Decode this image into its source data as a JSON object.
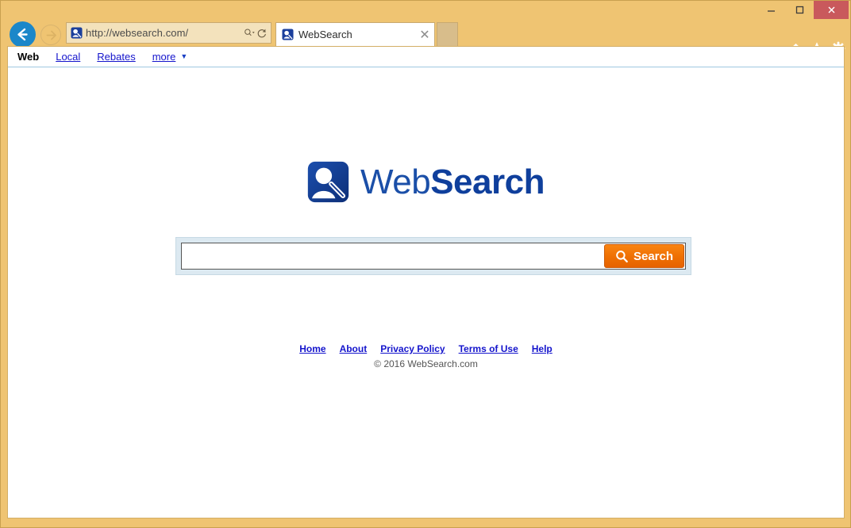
{
  "browser": {
    "window_controls": {
      "minimize": "minimize-icon",
      "maximize": "maximize-icon",
      "close": "close-icon"
    },
    "back_icon": "back-arrow-icon",
    "forward_icon": "forward-arrow-icon",
    "address": {
      "url": "http://websearch.com/",
      "favicon": "websearch-favicon",
      "search_icon": "search-dropdown-icon",
      "refresh_icon": "refresh-icon"
    },
    "tab": {
      "title": "WebSearch",
      "favicon": "websearch-favicon",
      "close_label": "✕"
    },
    "new_tab_label": "",
    "toolbar_icons": [
      "home-icon",
      "favorites-star-icon",
      "settings-gear-icon"
    ]
  },
  "sitenav": {
    "items": [
      {
        "label": "Web",
        "active": true
      },
      {
        "label": "Local",
        "active": false
      },
      {
        "label": "Rebates",
        "active": false
      }
    ],
    "more_label": "more",
    "more_caret": "▼"
  },
  "logo": {
    "mark": "websearch-logo-mark",
    "text_thin": "Web",
    "text_bold": "Search"
  },
  "search": {
    "value": "",
    "placeholder": "",
    "button_label": "Search",
    "button_icon": "magnifier-icon"
  },
  "footer": {
    "links": [
      "Home",
      "About",
      "Privacy Policy",
      "Terms of Use",
      "Help"
    ],
    "copyright": "© 2016 WebSearch.com"
  },
  "colors": {
    "chrome_gold": "#efc472",
    "close_red": "#c9595c",
    "back_blue": "#1b87c9",
    "link_blue": "#1414cc",
    "logo_blue": "#15459b",
    "search_orange": "#ee6f02",
    "searchframe_blue": "#dce9f1"
  }
}
